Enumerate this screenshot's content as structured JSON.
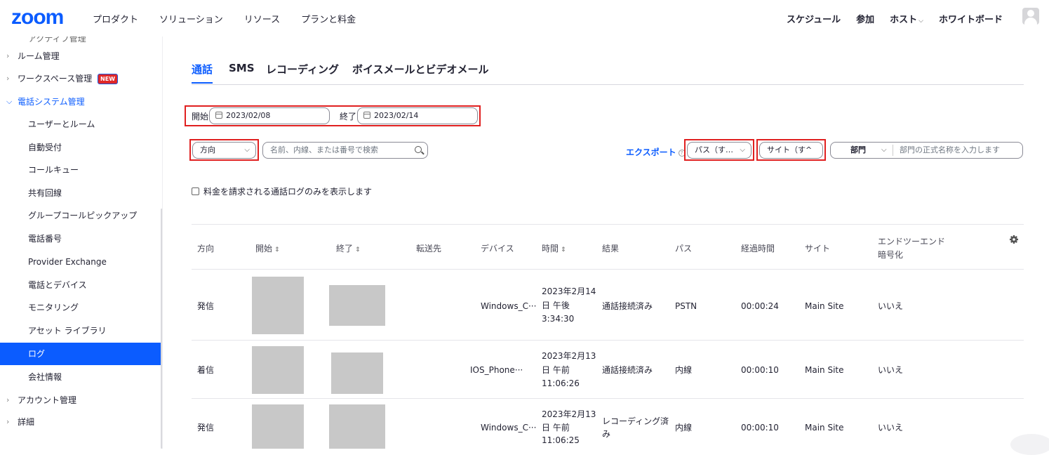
{
  "brand": {
    "logo": "zoom",
    "accent": "#0b5cff",
    "highlight": "#e02020"
  },
  "topnav": [
    "プロダクト",
    "ソリューション",
    "リソース",
    "プランと料金"
  ],
  "rightnav": {
    "schedule": "スケジュール",
    "join": "参加",
    "host": "ホスト",
    "whiteboard": "ホワイトボード",
    "host_chevron": "⌵"
  },
  "sidebar": {
    "cut_item": "アクティブ管理",
    "items": [
      {
        "label": "ルーム管理",
        "arrow": "›"
      },
      {
        "label": "ワークスペース管理",
        "arrow": "›",
        "badge": "NEW"
      },
      {
        "label": "電話システム管理",
        "arrow": "⌵"
      },
      {
        "label": "ユーザーとルーム"
      },
      {
        "label": "自動受付"
      },
      {
        "label": "コールキュー"
      },
      {
        "label": "共有回線"
      },
      {
        "label": "グループコールピックアップ"
      },
      {
        "label": "電話番号"
      },
      {
        "label": "Provider Exchange"
      },
      {
        "label": "電話とデバイス"
      },
      {
        "label": "モニタリング"
      },
      {
        "label": "アセット ライブラリ"
      },
      {
        "label": "ログ"
      },
      {
        "label": "会社情報"
      },
      {
        "label": "アカウント管理",
        "arrow": "›"
      },
      {
        "label": "詳細",
        "arrow": "›"
      }
    ]
  },
  "tabs": [
    "通話",
    "SMS",
    "レコーディング",
    "ボイスメールとビデオメール"
  ],
  "filters": {
    "start_label": "開始",
    "start_date": "2023/02/08",
    "end_label": "終了",
    "end_date": "2023/02/14",
    "direction": "方向",
    "search_placeholder": "名前、内線、または番号で検索",
    "export": "エクスポート",
    "path": "パス（す…",
    "site": "サイト（す^",
    "dept_label": "部門",
    "dept_placeholder": "部門の正式名称を入力します",
    "billing_checkbox": "料金を請求される通話ログのみを表示します",
    "dropdown_glyph": "⌵",
    "help_glyph": "?"
  },
  "table": {
    "headers": {
      "direction": "方向",
      "start": "開始",
      "end": "終了",
      "forward": "転送先",
      "device": "デバイス",
      "time": "時間",
      "result": "結果",
      "path": "パス",
      "elapsed": "経過時間",
      "site": "サイト",
      "e2e1": "エンドツーエンド",
      "e2e2": "暗号化",
      "sort_glyph": "⇕"
    },
    "rows": [
      {
        "direction": "発信",
        "device": "Windows_C···",
        "time1": "2023年2月14",
        "time2": "日 午後",
        "time3": "3:34:30",
        "result1": "通話接続済み",
        "result2": "",
        "path": "PSTN",
        "elapsed": "00:00:24",
        "site": "Main Site",
        "e2e": "いいえ"
      },
      {
        "direction": "着信",
        "device": "IOS_Phone···",
        "time1": "2023年2月13",
        "time2": "日 午前",
        "time3": "11:06:26",
        "result1": "通話接続済み",
        "result2": "",
        "path": "内線",
        "elapsed": "00:00:10",
        "site": "Main Site",
        "e2e": "いいえ"
      },
      {
        "direction": "発信",
        "device": "Windows_C···",
        "time1": "2023年2月13",
        "time2": "日 午前",
        "time3": "11:06:25",
        "result1": "レコーディング済",
        "result2": "み",
        "path": "内線",
        "elapsed": "00:00:10",
        "site": "Main Site",
        "e2e": "いいえ"
      }
    ]
  }
}
